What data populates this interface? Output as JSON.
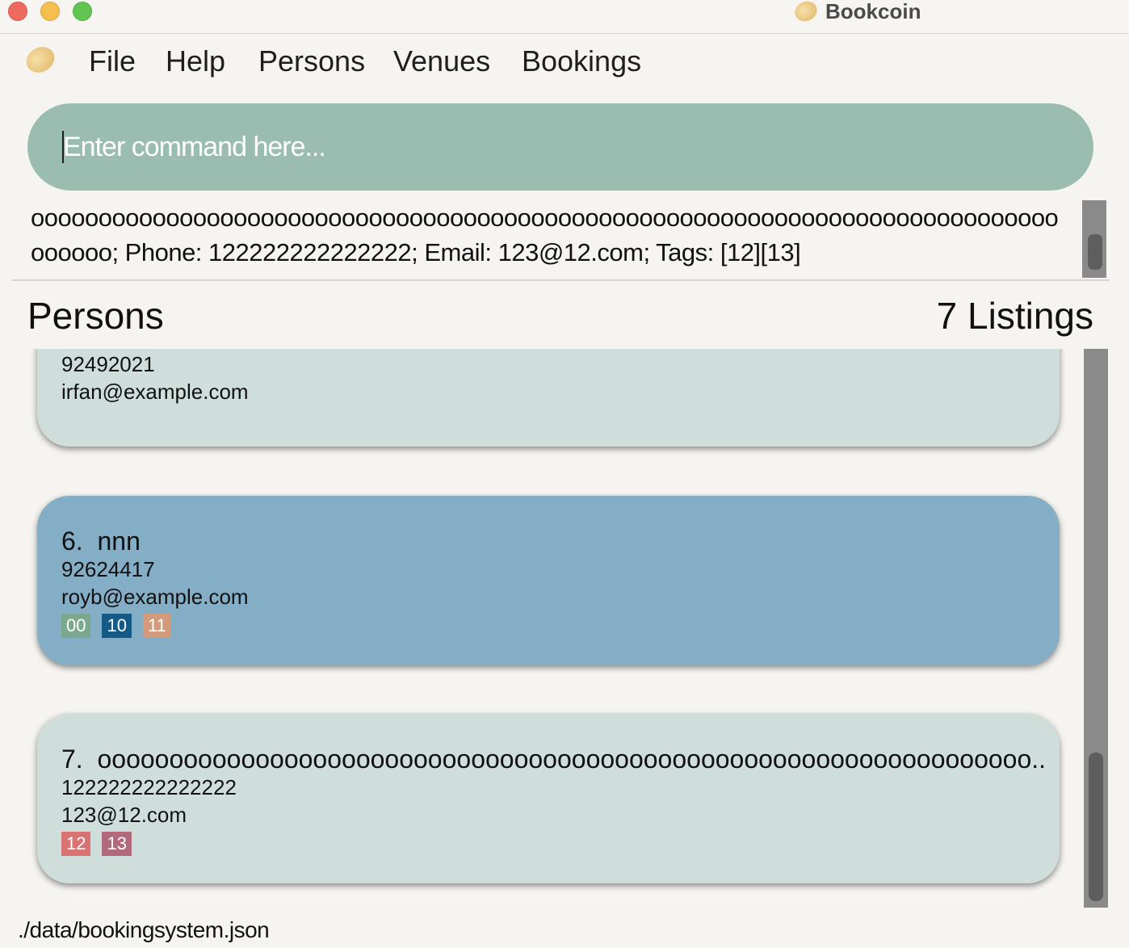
{
  "window": {
    "title": "Bookcoin",
    "controls": [
      "close",
      "minimize",
      "zoom"
    ]
  },
  "menu": {
    "logo_icon": "coin-icon",
    "items": [
      "File",
      "Help",
      "Persons",
      "Venues",
      "Bookings"
    ]
  },
  "command": {
    "value": "",
    "placeholder": "Enter command here..."
  },
  "result": {
    "text": "oooooooooooooooooooooooooooooooooooooooooooooooooooooooooooooooooooooooooooooooooo; Phone: 122222222222222; Email: 123@12.com; Tags: [12][13]"
  },
  "list": {
    "title": "Persons",
    "count": "7 Listings",
    "persons": [
      {
        "name": "",
        "phone": "92492021",
        "email": "irfan@example.com",
        "tags": []
      },
      {
        "index": "6.",
        "name": "nnn",
        "phone": "92624417",
        "email": "royb@example.com",
        "tags": [
          {
            "label": "00",
            "color": "#7ba88f"
          },
          {
            "label": "10",
            "color": "#155a87"
          },
          {
            "label": "11",
            "color": "#d39a7c"
          }
        ]
      },
      {
        "index": "7.",
        "name": "ooooooooooooooooooooooooooooooooooooooooooooooooooooooooooooooooo...",
        "phone": "122222222222222",
        "email": "123@12.com",
        "tags": [
          {
            "label": "12",
            "color": "#d97373"
          },
          {
            "label": "13",
            "color": "#b06a7c"
          }
        ]
      }
    ]
  },
  "status": {
    "file_path": "./data/bookingsystem.json"
  },
  "colors": {
    "command_bg": "#9abcb1",
    "card_bg": "#cfdeda",
    "card_selected_bg": "#84aec6",
    "scrollbar": "#8a8a8a"
  }
}
